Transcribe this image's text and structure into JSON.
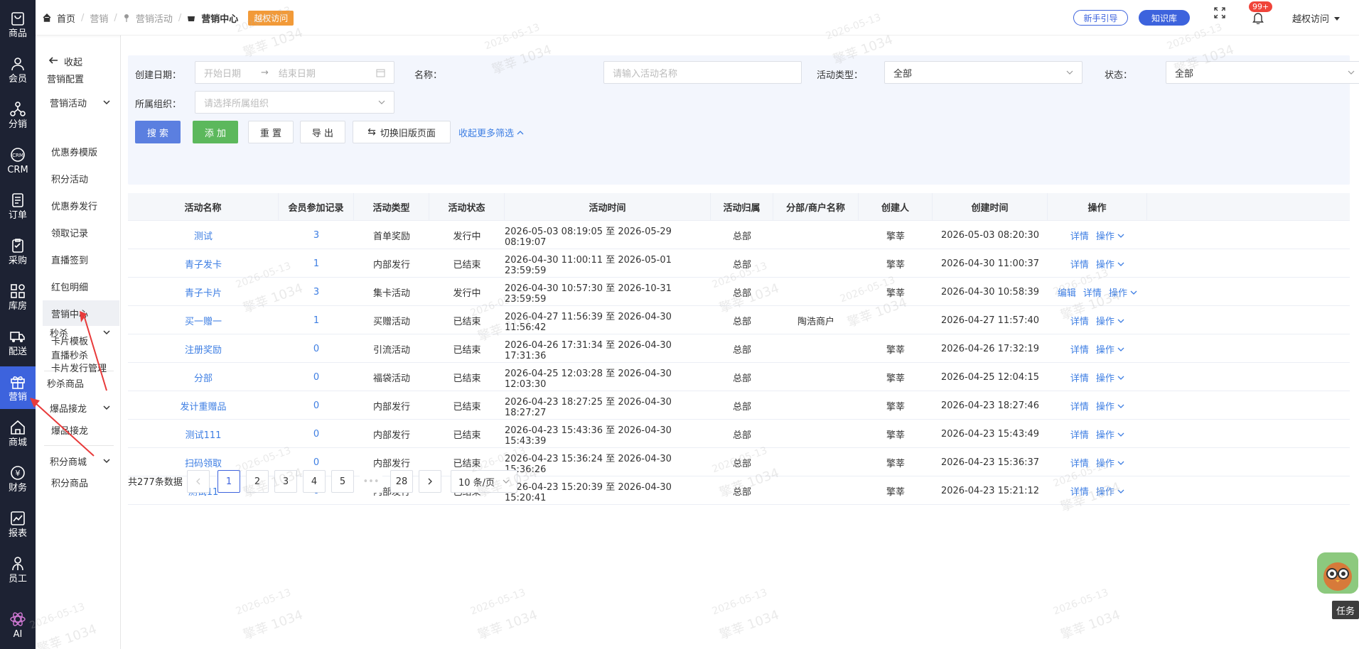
{
  "rail": {
    "items": [
      {
        "label": "商品",
        "icon": "product-icon"
      },
      {
        "label": "会员",
        "icon": "member-icon"
      },
      {
        "label": "分销",
        "icon": "distribution-icon"
      },
      {
        "label": "CRM",
        "icon": "crm-icon"
      },
      {
        "label": "订单",
        "icon": "order-icon"
      },
      {
        "label": "采购",
        "icon": "purchase-icon"
      },
      {
        "label": "库房",
        "icon": "warehouse-icon"
      },
      {
        "label": "配送",
        "icon": "delivery-icon"
      },
      {
        "label": "营销",
        "icon": "gift-icon"
      },
      {
        "label": "商城",
        "icon": "mall-icon"
      },
      {
        "label": "财务",
        "icon": "finance-icon"
      },
      {
        "label": "报表",
        "icon": "report-icon"
      },
      {
        "label": "员工",
        "icon": "staff-icon"
      },
      {
        "label": "AI",
        "icon": "ai-icon"
      }
    ],
    "active_index": 8
  },
  "submenu": {
    "collapse_label": "收起",
    "config_label": "营销配置",
    "group1": "营销活动",
    "group1_items": [
      "优惠券模版",
      "积分活动",
      "优惠券发行",
      "领取记录",
      "直播签到",
      "红包明细",
      "营销中心",
      "卡片模板",
      "卡片发行管理"
    ],
    "group2": "秒杀",
    "group2_items": [
      "直播秒杀"
    ],
    "item_miaosha": "秒杀商品",
    "group3": "爆品接龙",
    "group3_items": [
      "爆品接龙"
    ],
    "group4": "积分商城",
    "group4_items": [
      "积分商品"
    ]
  },
  "topbar": {
    "breadcrumb": [
      "首页",
      "营销",
      "营销活动",
      "营销中心"
    ],
    "badge": "越权访问",
    "guide_btn": "新手引导",
    "kb_btn": "知识库",
    "notif_count": "99+",
    "user": "越权访问"
  },
  "filter": {
    "date_label": "创建日期：",
    "start_ph": "开始日期",
    "end_ph": "结束日期",
    "name_label": "名称：",
    "name_ph": "请输入活动名称",
    "type_label": "活动类型：",
    "type_val": "全部",
    "status_label": "状态：",
    "status_val": "全部",
    "org_label": "所属组织：",
    "org_ph": "请选择所属组织",
    "search": "搜 索",
    "add": "添 加",
    "reset": "重 置",
    "export": "导 出",
    "switch_old": "切换旧版页面",
    "collapse_more": "收起更多筛选"
  },
  "table": {
    "headers": [
      "活动名称",
      "会员参加记录",
      "活动类型",
      "活动状态",
      "活动时间",
      "活动归属",
      "分部/商户名称",
      "创建人",
      "创建时间",
      "操作"
    ],
    "rows": [
      {
        "name": "测试",
        "count": "3",
        "type": "首单奖励",
        "status": "发行中",
        "time": "2026-05-03 08:19:05 至 2026-05-29 08:19:07",
        "owner": "总部",
        "branch": "",
        "creator": "擎莘",
        "created": "2026-05-03 08:20:30",
        "ops": [
          "详情",
          "操作"
        ]
      },
      {
        "name": "青子发卡",
        "count": "1",
        "type": "内部发行",
        "status": "已结束",
        "time": "2026-04-30 11:00:11 至 2026-05-01 23:59:59",
        "owner": "总部",
        "branch": "",
        "creator": "擎莘",
        "created": "2026-04-30 11:00:37",
        "ops": [
          "详情",
          "操作"
        ]
      },
      {
        "name": "青子卡片",
        "count": "3",
        "type": "集卡活动",
        "status": "发行中",
        "time": "2026-04-30 10:57:30 至 2026-10-31 23:59:59",
        "owner": "总部",
        "branch": "",
        "creator": "擎莘",
        "created": "2026-04-30 10:58:39",
        "ops": [
          "编辑",
          "详情",
          "操作"
        ]
      },
      {
        "name": "买一赠一",
        "count": "1",
        "type": "买赠活动",
        "status": "已结束",
        "time": "2026-04-27 11:56:39 至 2026-04-30 11:56:42",
        "owner": "总部",
        "branch": "陶浩商户",
        "creator": "",
        "created": "2026-04-27 11:57:40",
        "ops": [
          "详情",
          "操作"
        ]
      },
      {
        "name": "注册奖励",
        "count": "0",
        "type": "引流活动",
        "status": "已结束",
        "time": "2026-04-26 17:31:34 至 2026-04-30 17:31:36",
        "owner": "总部",
        "branch": "",
        "creator": "擎莘",
        "created": "2026-04-26 17:32:19",
        "ops": [
          "详情",
          "操作"
        ]
      },
      {
        "name": "分部",
        "count": "0",
        "type": "福袋活动",
        "status": "已结束",
        "time": "2026-04-25 12:03:28 至 2026-04-30 12:03:30",
        "owner": "总部",
        "branch": "",
        "creator": "擎莘",
        "created": "2026-04-25 12:04:15",
        "ops": [
          "详情",
          "操作"
        ]
      },
      {
        "name": "发计重赠品",
        "count": "0",
        "type": "内部发行",
        "status": "已结束",
        "time": "2026-04-23 18:27:25 至 2026-04-30 18:27:27",
        "owner": "总部",
        "branch": "",
        "creator": "擎莘",
        "created": "2026-04-23 18:27:46",
        "ops": [
          "详情",
          "操作"
        ]
      },
      {
        "name": "测试111",
        "count": "0",
        "type": "内部发行",
        "status": "已结束",
        "time": "2026-04-23 15:43:36 至 2026-04-30 15:43:39",
        "owner": "总部",
        "branch": "",
        "creator": "擎莘",
        "created": "2026-04-23 15:43:49",
        "ops": [
          "详情",
          "操作"
        ]
      },
      {
        "name": "扫码领取",
        "count": "0",
        "type": "内部发行",
        "status": "已结束",
        "time": "2026-04-23 15:36:24 至 2026-04-30 15:36:26",
        "owner": "总部",
        "branch": "",
        "creator": "擎莘",
        "created": "2026-04-23 15:36:37",
        "ops": [
          "详情",
          "操作"
        ]
      },
      {
        "name": "测试11",
        "count": "0",
        "type": "内部发行",
        "status": "已结束",
        "time": "2026-04-23 15:20:39 至 2026-04-30 15:20:41",
        "owner": "总部",
        "branch": "",
        "creator": "擎莘",
        "created": "2026-04-23 15:21:12",
        "ops": [
          "详情",
          "操作"
        ]
      }
    ]
  },
  "pager": {
    "total": "共277条数据",
    "pages": [
      "1",
      "2",
      "3",
      "4",
      "5",
      "•••",
      "28"
    ],
    "current": "1",
    "size": "10 条/页"
  },
  "watermark": {
    "date": "2026-05-13",
    "user": "擎莘 1034"
  },
  "float": {
    "task": "任务"
  },
  "colors": {
    "accent": "#3d63dd",
    "link": "#3d7ee3",
    "green": "#5cb85c",
    "rail": "#1d2233",
    "orange": "#f29a38"
  }
}
